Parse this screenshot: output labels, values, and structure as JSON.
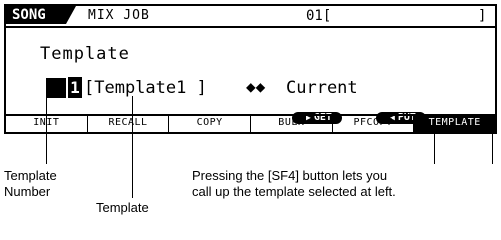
{
  "lcd": {
    "mode": "SONG",
    "job": "MIX JOB",
    "song_number": "01[",
    "song_bracket_close": "]",
    "title": "Template",
    "template_number": "1",
    "template_name": "[Template1 ]",
    "arrows": "◆◆",
    "current": "Current",
    "buttons": [
      {
        "label": "GET"
      },
      {
        "label": "PUT"
      }
    ],
    "menu": [
      "INIT",
      "RECALL",
      "COPY",
      "BULK",
      "PFCOPY",
      "TEMPLATE"
    ]
  },
  "callouts": {
    "template_number": "Template\nNumber",
    "template": "Template",
    "description_line1": "Pressing the [SF4] button lets you",
    "description_line2": "call up the template selected at left."
  }
}
